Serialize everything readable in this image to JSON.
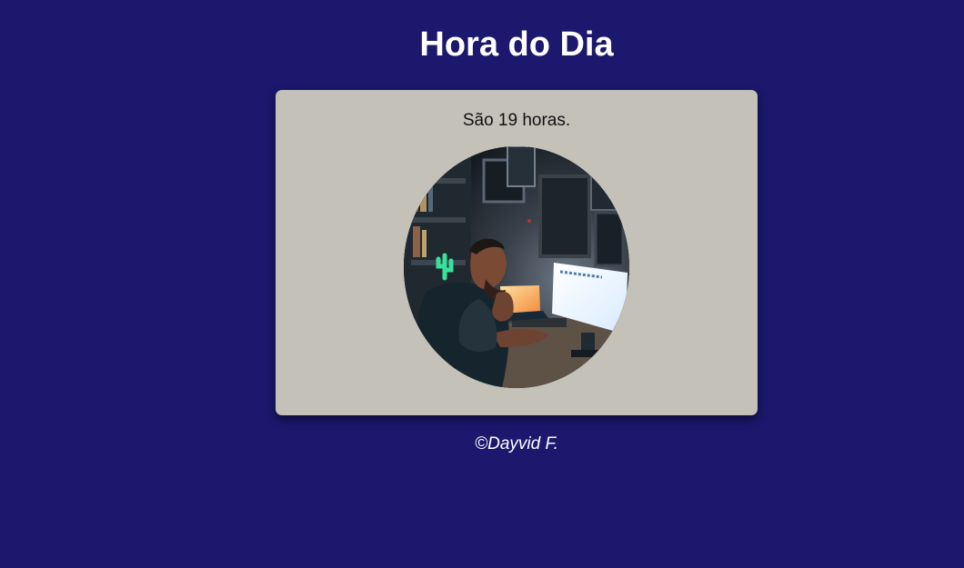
{
  "header": {
    "title": "Hora do Dia"
  },
  "card": {
    "message": "São 19 horas.",
    "image": {
      "icon": "night-workstation-photo"
    },
    "colors": {
      "background": "#c4c1b9"
    }
  },
  "footer": {
    "copyright": "©Dayvid F."
  },
  "colors": {
    "page_background": "#1b186e",
    "title": "#ffffff"
  }
}
